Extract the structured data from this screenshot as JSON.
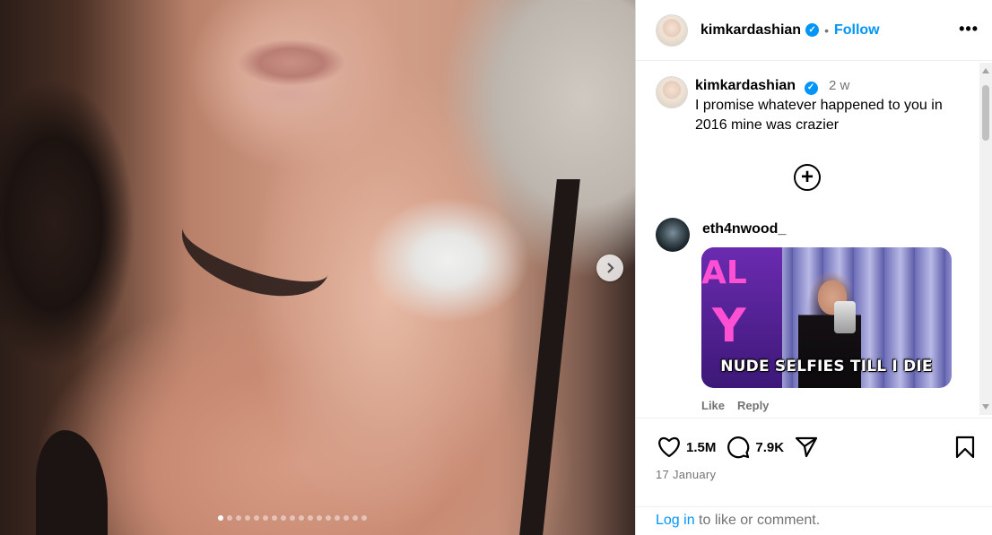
{
  "post": {
    "username": "kimkardashian",
    "follow_label": "Follow",
    "separator": "•",
    "more_icon": "more-icon"
  },
  "media": {
    "slide_count": 17,
    "active_slide": 1
  },
  "caption": {
    "username": "kimkardashian",
    "time": "2 w",
    "text": "I promise whatever happened to you in 2016 mine was crazier"
  },
  "comment": {
    "username": "eth4nwood_",
    "gif_caption": "NUDE SELFIES TILL I DIE",
    "gif_text_top": "AL",
    "gif_text_mid": "Y",
    "like_label": "Like",
    "reply_label": "Reply"
  },
  "stats": {
    "likes": "1.5M",
    "comments": "7.9K",
    "date": "17 January"
  },
  "login": {
    "link": "Log in",
    "text": " to like or comment."
  },
  "colors": {
    "accent": "#0095f6",
    "muted": "#737373"
  }
}
